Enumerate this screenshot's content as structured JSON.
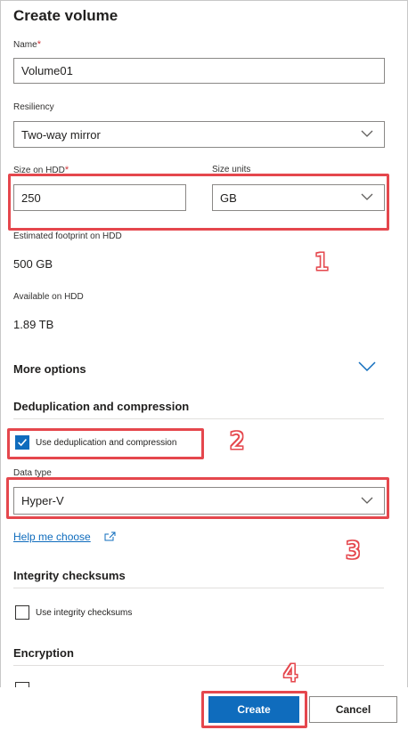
{
  "panel": {
    "title": "Create volume"
  },
  "name_field": {
    "label": "Name",
    "required_mark": "*",
    "value": "Volume01"
  },
  "resiliency": {
    "label": "Resiliency",
    "selected": "Two-way mirror"
  },
  "size": {
    "label": "Size on HDD",
    "required_mark": "*",
    "value": "250"
  },
  "size_units": {
    "label": "Size units",
    "selected": "GB"
  },
  "footprint": {
    "label": "Estimated footprint on HDD",
    "value": "500 GB"
  },
  "available": {
    "label": "Available on HDD",
    "value": "1.89 TB"
  },
  "more_options": {
    "label": "More options"
  },
  "dedup": {
    "section_title": "Deduplication and compression",
    "checkbox_label": "Use deduplication and compression",
    "checked": true,
    "data_type_label": "Data type",
    "data_type_selected": "Hyper-V",
    "help_link": "Help me choose"
  },
  "integrity": {
    "section_title": "Integrity checksums",
    "checkbox_label": "Use integrity checksums",
    "checked": false
  },
  "encryption": {
    "section_title": "Encryption"
  },
  "buttons": {
    "create": "Create",
    "cancel": "Cancel"
  },
  "annotations": {
    "step1": "1",
    "step2": "2",
    "step3": "3",
    "step4": "4"
  },
  "colors": {
    "accent": "#0f6cbd",
    "highlight": "#e5474d",
    "required": "#d13438"
  }
}
